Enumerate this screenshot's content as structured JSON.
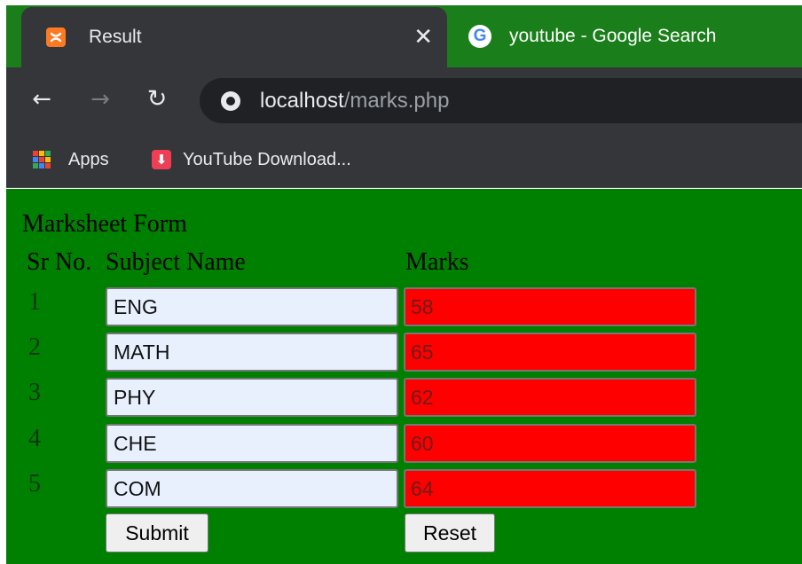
{
  "browser": {
    "tabs": [
      {
        "title": "Result",
        "favicon": "xampp-icon",
        "active": true,
        "close_label": "✕"
      },
      {
        "title": "youtube - Google Search",
        "favicon": "google-icon",
        "active": false,
        "favicon_glyph": "G"
      }
    ],
    "toolbar": {
      "back_glyph": "←",
      "forward_glyph": "→",
      "reload_glyph": "↻",
      "url_host": "localhost",
      "url_path": "/marks.php"
    },
    "bookmarks": [
      {
        "label": "Apps",
        "icon": "apps-grid-icon"
      },
      {
        "label": "YouTube Download...",
        "icon": "download-icon",
        "icon_glyph": "⬇"
      }
    ],
    "colors": {
      "tab_strip": "#1a7f1a",
      "toolbar": "#35363a",
      "omnibox": "#202124"
    }
  },
  "page": {
    "title": "Marksheet Form",
    "columns": {
      "sr": "Sr No.",
      "subject": "Subject Name",
      "marks": "Marks"
    },
    "rows": [
      {
        "sr": "1",
        "subject": "ENG",
        "marks": "58"
      },
      {
        "sr": "2",
        "subject": "MATH",
        "marks": "65"
      },
      {
        "sr": "3",
        "subject": "PHY",
        "marks": "62"
      },
      {
        "sr": "4",
        "subject": "CHE",
        "marks": "60"
      },
      {
        "sr": "5",
        "subject": "COM",
        "marks": "64"
      }
    ],
    "buttons": {
      "submit": "Submit",
      "reset": "Reset"
    },
    "colors": {
      "background": "#008000",
      "marks_field": "#ff0000",
      "subject_field": "#e8f0fe"
    }
  }
}
